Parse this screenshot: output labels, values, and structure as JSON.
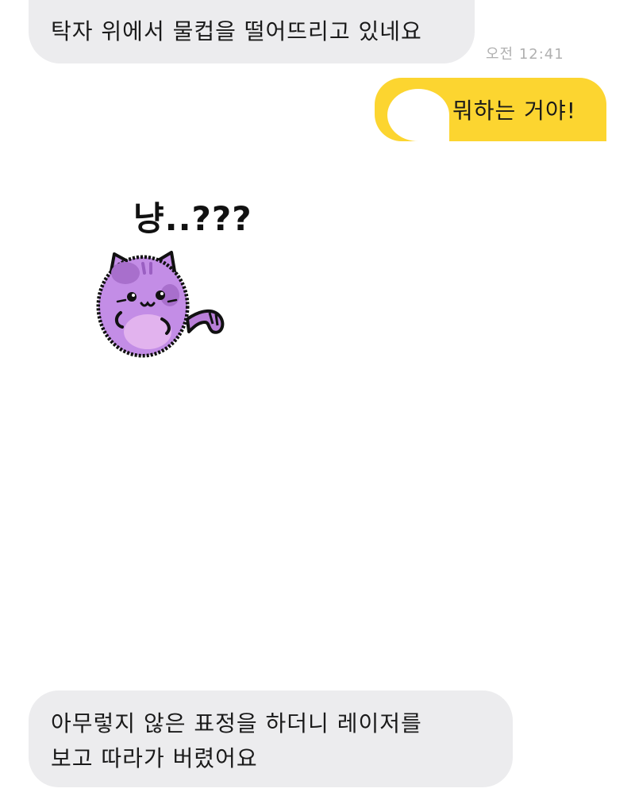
{
  "messages": [
    {
      "side": "left",
      "text": "탁자 위에서 물컵을 떨어뜨리고 있네요"
    },
    {
      "side": "right",
      "text": "뭐하는 거야!"
    },
    {
      "side": "left",
      "lines": [
        "아무렇지 않은 표정을 하더니 레이저를",
        "보고 따라가 버렸어요"
      ]
    }
  ],
  "timestamp": "오전 12:41",
  "sticker": {
    "caption": "냥..???",
    "name": "purple-cat-sticker"
  },
  "colors": {
    "left_bubble": "#ececee",
    "right_bubble": "#fcd530",
    "timestamp": "#b0b0b0",
    "cat_body": "#c38de6",
    "cat_belly": "#e2b3ee"
  }
}
